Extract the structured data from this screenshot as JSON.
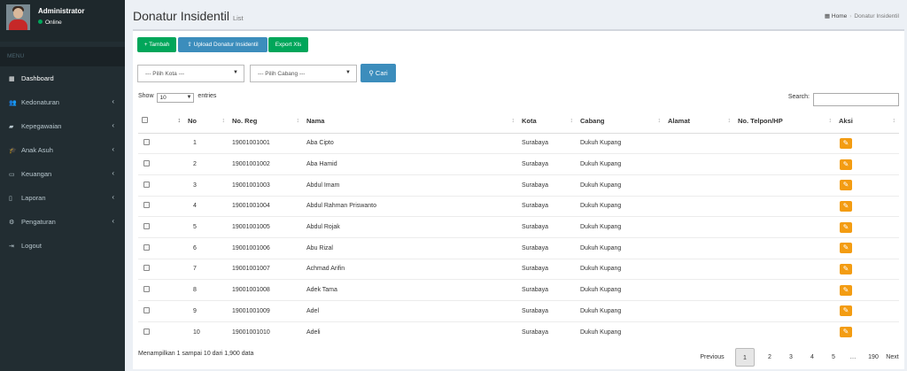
{
  "sidebar": {
    "user_name": "Administrator",
    "user_status": "Online",
    "menu_header": "MENU",
    "items": [
      {
        "label": "Dashboard",
        "icon": "th-icon",
        "glyph": "▦"
      },
      {
        "label": "Kedonaturan",
        "icon": "users-icon",
        "glyph": "👥"
      },
      {
        "label": "Kepegawaian",
        "icon": "briefcase-icon",
        "glyph": "▰"
      },
      {
        "label": "Anak Asuh",
        "icon": "graduation-cap-icon",
        "glyph": "🎓"
      },
      {
        "label": "Keuangan",
        "icon": "money-icon",
        "glyph": "▭"
      },
      {
        "label": "Laporan",
        "icon": "file-icon",
        "glyph": "▯"
      },
      {
        "label": "Pengaturan",
        "icon": "cog-icon",
        "glyph": "⚙"
      },
      {
        "label": "Logout",
        "icon": "sign-out-icon",
        "glyph": "⇥"
      }
    ]
  },
  "header": {
    "title": "Donatur Insidentil",
    "subtitle": "List",
    "breadcrumb_home": "Home",
    "breadcrumb_current": "Donatur Insidentil"
  },
  "toolbar": {
    "tambah": "+ Tambah",
    "upload": "Upload Donatur Insidentil",
    "export": "Export Xls",
    "kota_select": "--- Pilih Kota ---",
    "cabang_select": "--- Pilih Cabang ---",
    "cari": "Cari"
  },
  "table_controls": {
    "show": "Show",
    "length_value": "10",
    "entries": "entries",
    "search_label": "Search:"
  },
  "columns": [
    "No",
    "No. Reg",
    "Nama",
    "Kota",
    "Cabang",
    "Alamat",
    "No. Telpon/HP",
    "Aksi"
  ],
  "rows": [
    {
      "no": "1",
      "reg": "19001001001",
      "nama": "Aba Cipto",
      "kota": "Surabaya",
      "cabang": "Dukuh Kupang",
      "alamat": "",
      "telp": ""
    },
    {
      "no": "2",
      "reg": "19001001002",
      "nama": "Aba Hamid",
      "kota": "Surabaya",
      "cabang": "Dukuh Kupang",
      "alamat": "",
      "telp": ""
    },
    {
      "no": "3",
      "reg": "19001001003",
      "nama": "Abdul Imam",
      "kota": "Surabaya",
      "cabang": "Dukuh Kupang",
      "alamat": "",
      "telp": ""
    },
    {
      "no": "4",
      "reg": "19001001004",
      "nama": "Abdul Rahman Priswanto",
      "kota": "Surabaya",
      "cabang": "Dukuh Kupang",
      "alamat": "",
      "telp": ""
    },
    {
      "no": "5",
      "reg": "19001001005",
      "nama": "Abdul Rojak",
      "kota": "Surabaya",
      "cabang": "Dukuh Kupang",
      "alamat": "",
      "telp": ""
    },
    {
      "no": "6",
      "reg": "19001001006",
      "nama": "Abu Rizal",
      "kota": "Surabaya",
      "cabang": "Dukuh Kupang",
      "alamat": "",
      "telp": ""
    },
    {
      "no": "7",
      "reg": "19001001007",
      "nama": "Achmad Arifin",
      "kota": "Surabaya",
      "cabang": "Dukuh Kupang",
      "alamat": "",
      "telp": ""
    },
    {
      "no": "8",
      "reg": "19001001008",
      "nama": "Adek Tama",
      "kota": "Surabaya",
      "cabang": "Dukuh Kupang",
      "alamat": "",
      "telp": ""
    },
    {
      "no": "9",
      "reg": "19001001009",
      "nama": "Adel",
      "kota": "Surabaya",
      "cabang": "Dukuh Kupang",
      "alamat": "",
      "telp": ""
    },
    {
      "no": "10",
      "reg": "19001001010",
      "nama": "Adeli",
      "kota": "Surabaya",
      "cabang": "Dukuh Kupang",
      "alamat": "",
      "telp": ""
    }
  ],
  "footer": {
    "info": "Menampilkan 1 sampai 10 dari 1,900 data",
    "pagination": [
      "Previous",
      "1",
      "2",
      "3",
      "4",
      "5",
      "…",
      "190",
      "Next"
    ],
    "current_page": "1"
  },
  "colors": {
    "sidebar": "#222d32",
    "green": "#00a65a",
    "blue": "#3c8dbc",
    "orange": "#f39c12"
  }
}
